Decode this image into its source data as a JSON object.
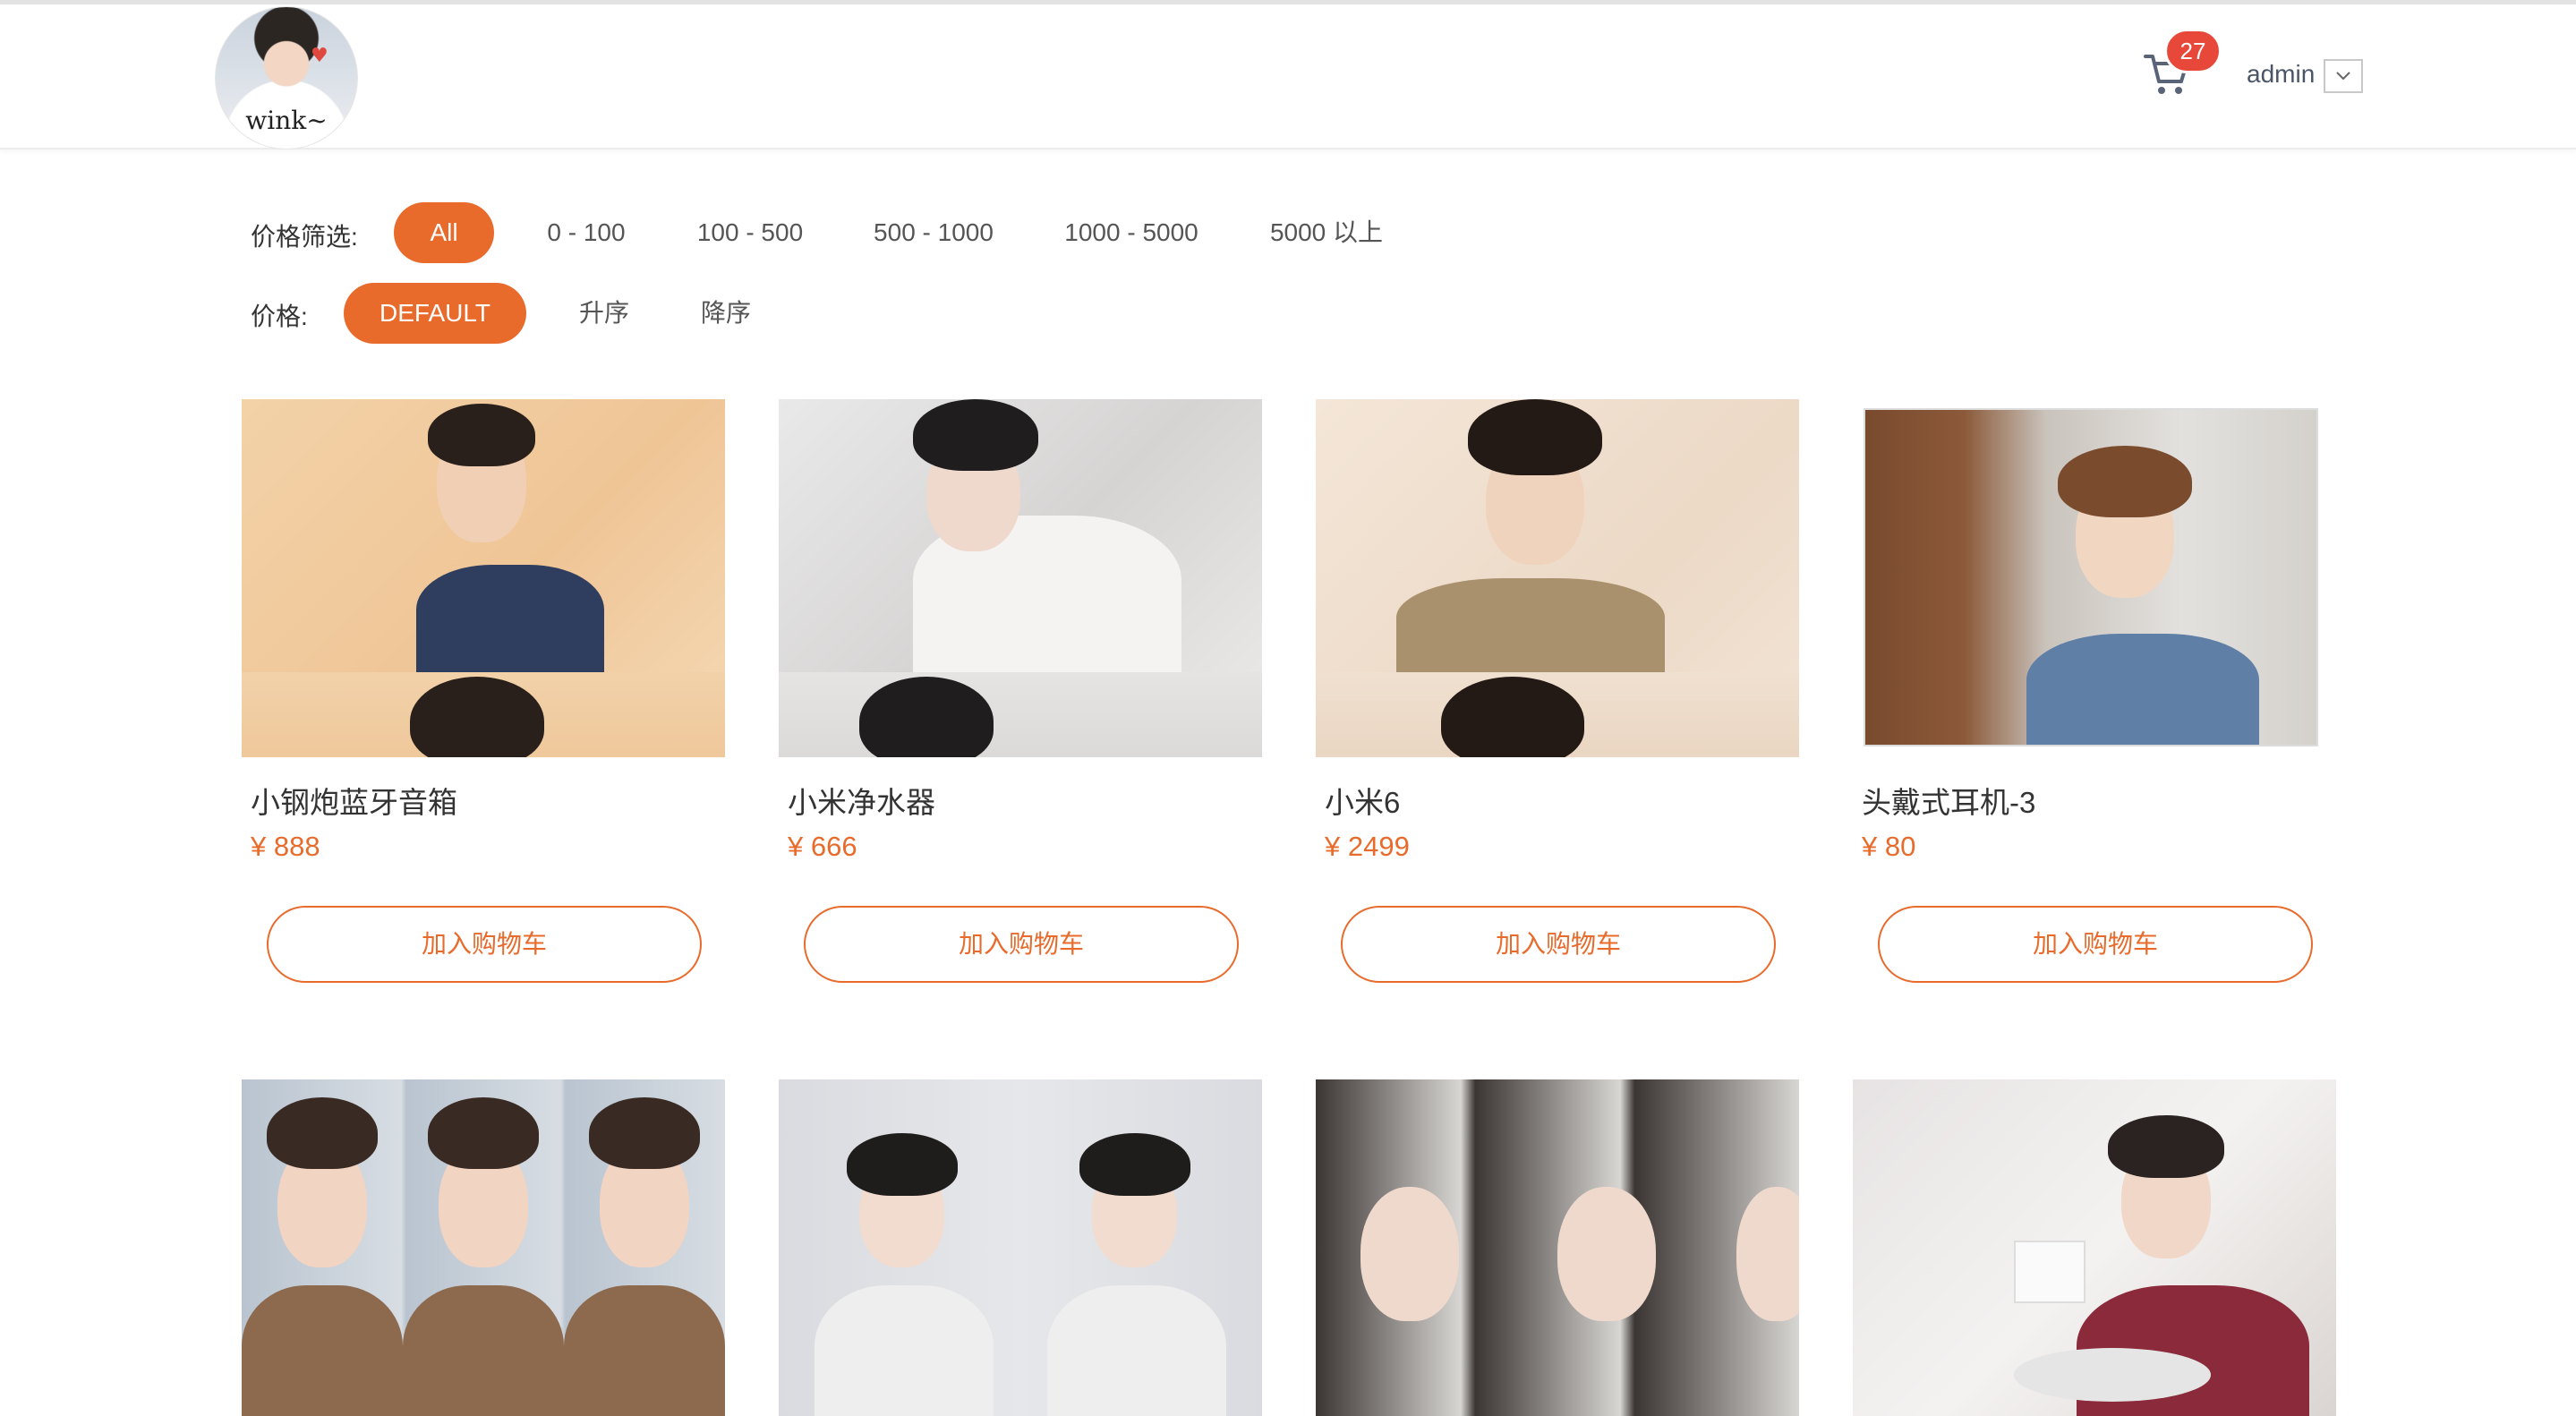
{
  "header": {
    "logo_text": "wink~",
    "cart_count": "27",
    "user_name": "admin",
    "accent_color": "#e86b2c",
    "badge_color": "#e8483a"
  },
  "filters": {
    "price_range_label": "价格筛选:",
    "price_ranges": [
      "All",
      "0 - 100",
      "100 - 500",
      "500 - 1000",
      "1000 - 5000",
      "5000 以上"
    ],
    "price_range_selected": "All",
    "sort_label": "价格:",
    "sort_options": [
      "DEFAULT",
      "升序",
      "降序"
    ],
    "sort_selected": "DEFAULT"
  },
  "products": [
    {
      "name": "小钢炮蓝牙音箱",
      "price": "¥ 888",
      "button": "加入购物车"
    },
    {
      "name": "小米净水器",
      "price": "¥ 666",
      "button": "加入购物车"
    },
    {
      "name": "小米6",
      "price": "¥ 2499",
      "button": "加入购物车"
    },
    {
      "name": "头戴式耳机-3",
      "price": "¥ 80",
      "button": "加入购物车"
    }
  ],
  "icons": {
    "cart": "cart-icon",
    "dropdown": "chevron-down-icon"
  }
}
